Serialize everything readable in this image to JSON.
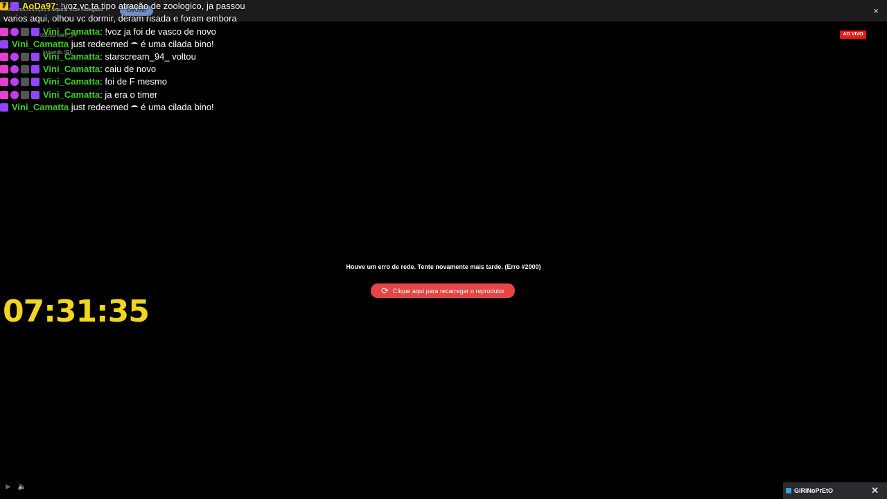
{
  "automation_banner": {
    "text": "Automa começou a depurar esse navegador",
    "cancel_label": "Cancelar",
    "close_label": "×"
  },
  "chat": {
    "first": {
      "user": "AoDa97",
      "message": "!voz vc ta tipo atração de zoologico, ja passou",
      "message_cont": "varios aqui, olhou vc dormir, deram risada e foram embora"
    },
    "lines": [
      {
        "user": "Vini_Camatta",
        "message": "!voz ja foi de vasco de novo"
      },
      {
        "user": "Vini_Camatta",
        "message": "just redeemed",
        "redeem": "é uma cilada bino!"
      },
      {
        "user": "Vini_Camatta",
        "message": "starscream_94_ voltou"
      },
      {
        "user": "Vini_Camatta",
        "message": "caiu de novo"
      },
      {
        "user": "Vini_Camatta",
        "message": "foi de F mesmo"
      },
      {
        "user": "Vini_Camatta",
        "message": "ja era o timer"
      },
      {
        "user": "Vini_Camatta",
        "message": "just redeemed",
        "redeem": "é uma cilada bino!"
      }
    ],
    "ghost_text": {
      "user": "starscream_94",
      "status": "jogando IRL"
    }
  },
  "timer": "07:31:35",
  "live_badge": "AO VIVO",
  "error": {
    "message": "Houve um erro de rede. Tente novamente mais tarde. (Erro #2000)",
    "reload_label": "Clique aqui para recarregar o reprodutor"
  },
  "channel_pill": {
    "name": "GiRiNoPrEtO",
    "close_label": "✕"
  },
  "colors": {
    "username_green": "#3bd11f",
    "username_yellow": "#ffe300",
    "timer": "#f2d51e",
    "live": "#e91916",
    "reload_button": "#e44545"
  }
}
